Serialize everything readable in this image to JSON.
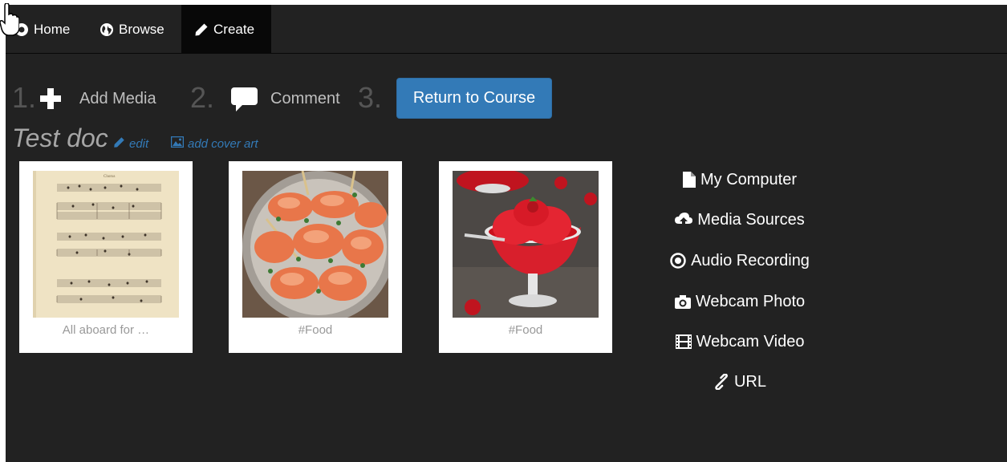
{
  "nav": {
    "home_label": "Home",
    "browse_label": "Browse",
    "create_label": "Create"
  },
  "steps": [
    {
      "number": "1.",
      "label": "Add Media"
    },
    {
      "number": "2.",
      "label": "Comment"
    },
    {
      "number": "3.",
      "button_label": "Return to Course"
    }
  ],
  "doc": {
    "title": "Test doc",
    "edit_label": "edit",
    "cover_label": "add cover art"
  },
  "cards": [
    {
      "caption": "All aboard for …",
      "image": "sheet-music"
    },
    {
      "caption": "#Food",
      "image": "shrimp-dish"
    },
    {
      "caption": "#Food",
      "image": "strawberry-sorbet"
    }
  ],
  "sources": [
    {
      "label": "My Computer",
      "icon": "file-icon"
    },
    {
      "label": "Media Sources",
      "icon": "cloud-upload-icon"
    },
    {
      "label": "Audio Recording",
      "icon": "record-icon"
    },
    {
      "label": "Webcam Photo",
      "icon": "camera-icon"
    },
    {
      "label": "Webcam Video",
      "icon": "film-icon"
    },
    {
      "label": "URL",
      "icon": "link-icon"
    }
  ],
  "colors": {
    "background": "#222222",
    "navbar_active": "#080808",
    "primary": "#337ab7",
    "step_number": "#555555"
  }
}
